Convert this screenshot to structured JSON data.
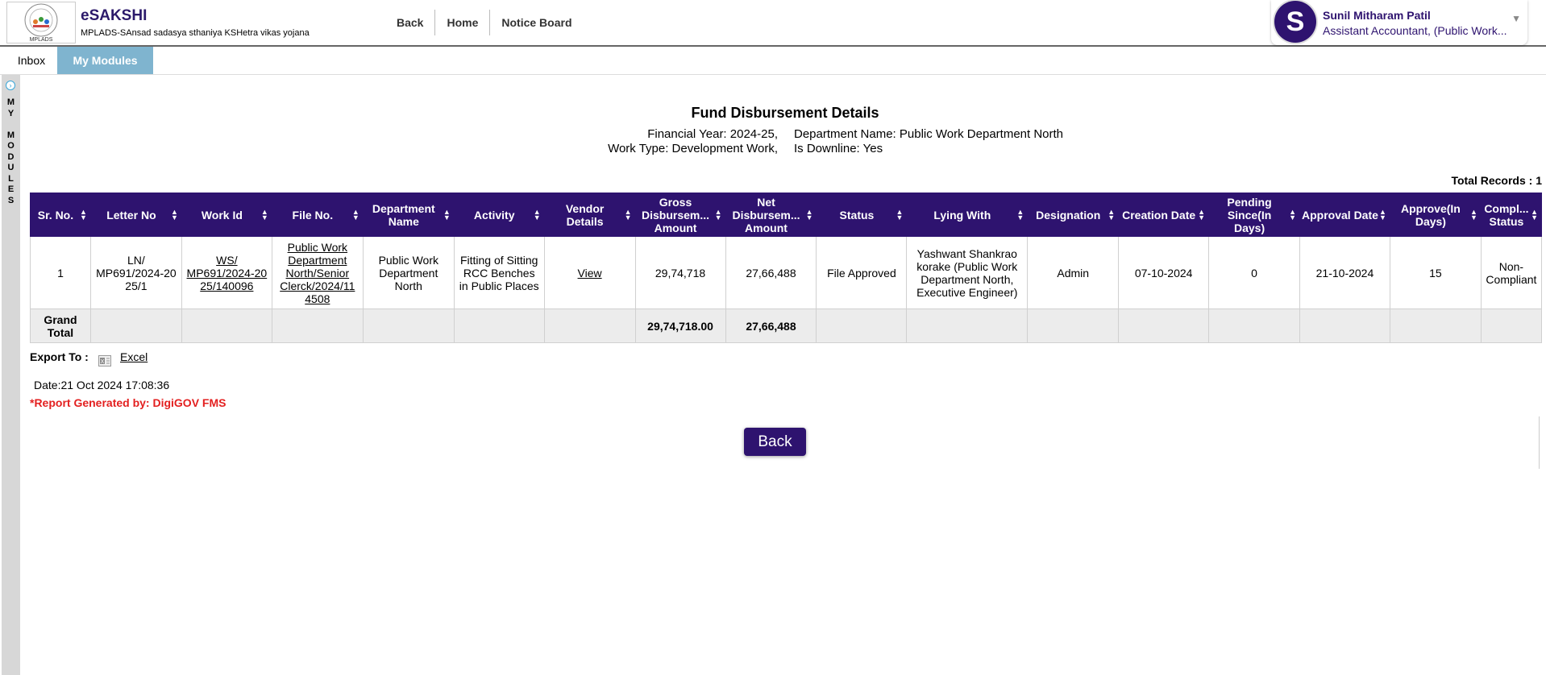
{
  "header": {
    "app_title": "eSAKSHI",
    "app_subtitle": "MPLADS-SAnsad sadasya sthaniya KSHetra vikas yojana",
    "logo_text": "MPLADS",
    "nav": [
      "Back",
      "Home",
      "Notice Board"
    ],
    "user": {
      "initial": "S",
      "name": "Sunil Mitharam Patil",
      "role": "Assistant Accountant, (Public Work..."
    }
  },
  "tabs": {
    "inbox": "Inbox",
    "modules": "My Modules"
  },
  "side_rail": {
    "label": "M\nY\n\nM\nO\nD\nU\nL\nE\nS"
  },
  "report": {
    "title": "Fund Disbursement Details",
    "financial_year": "Financial Year: 2024-25,",
    "department_name": "Department Name: Public Work Department North",
    "work_type": "Work Type: Development Work,",
    "is_downline": "Is Downline: Yes",
    "total_records": "Total Records : 1"
  },
  "table": {
    "headers": [
      "Sr. No.",
      "Letter No",
      "Work Id",
      "File No.",
      "Department Name",
      "Activity",
      "Vendor Details",
      "Gross Disbursem... Amount",
      "Net Disbursem... Amount",
      "Status",
      "Lying With",
      "Designation",
      "Creation Date",
      "Pending Since(In Days)",
      "Approval Date",
      "Approve(In Days)",
      "Compl... Status"
    ],
    "row": {
      "sr_no": "1",
      "letter_no": "LN/ MP691/2024-20 25/1",
      "work_id": "WS/ MP691/2024-20 25/140096",
      "file_no": "Public Work Department North/Senior Clerck/2024/11 4508",
      "department_name": "Public Work Department North",
      "activity": "Fitting of Sitting RCC Benches in Public Places",
      "vendor_details": "View",
      "gross_amount": "29,74,718",
      "net_amount": "27,66,488",
      "status": "File Approved",
      "lying_with": "Yashwant Shankrao korake (Public Work Department North, Executive Engineer)",
      "designation": "Admin",
      "creation_date": "07-10-2024",
      "pending_since": "0",
      "approval_date": "21-10-2024",
      "approve_days": "15",
      "compliance_status": "Non-Compliant"
    },
    "total": {
      "label": "Grand Total",
      "gross_amount": "29,74,718.00",
      "net_amount": "27,66,488"
    }
  },
  "export": {
    "label": "Export To :",
    "excel": "Excel"
  },
  "footer": {
    "date": "Date:21 Oct 2024 17:08:36",
    "generated_by": "*Report Generated by: DigiGOV FMS",
    "back_button": "Back"
  },
  "colors": {
    "primary": "#2e136f",
    "tab_active": "#7fb4cf",
    "alert": "#e32020",
    "total_row": "#ececec"
  }
}
